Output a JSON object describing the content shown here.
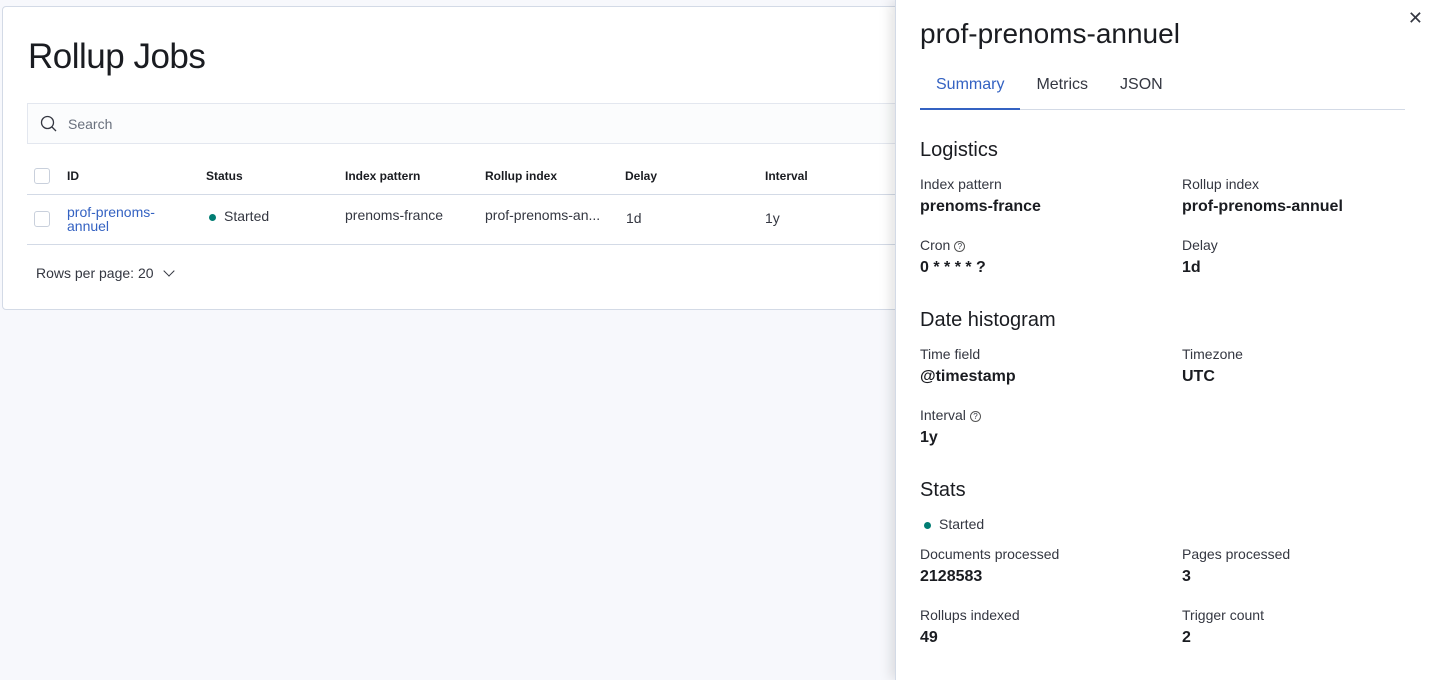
{
  "page": {
    "title": "Rollup Jobs",
    "search_placeholder": "Search"
  },
  "table": {
    "headers": [
      "ID",
      "Status",
      "Index pattern",
      "Rollup index",
      "Delay",
      "Interval"
    ],
    "rows": [
      {
        "id_line1": "prof-prenoms-",
        "id_line2": "annuel",
        "status": "Started",
        "index_pattern": "prenoms-france",
        "rollup_index": "prof-prenoms-an...",
        "delay": "1d",
        "interval": "1y"
      }
    ],
    "rows_per_page": "Rows per page: 20"
  },
  "flyout": {
    "title": "prof-prenoms-annuel",
    "tabs": [
      "Summary",
      "Metrics",
      "JSON"
    ],
    "logistics": {
      "heading": "Logistics",
      "index_pattern_label": "Index pattern",
      "index_pattern": "prenoms-france",
      "rollup_index_label": "Rollup index",
      "rollup_index": "prof-prenoms-annuel",
      "cron_label": "Cron",
      "cron": "0 * * * * ?",
      "delay_label": "Delay",
      "delay": "1d"
    },
    "date_histogram": {
      "heading": "Date histogram",
      "time_field_label": "Time field",
      "time_field": "@timestamp",
      "timezone_label": "Timezone",
      "timezone": "UTC",
      "interval_label": "Interval",
      "interval": "1y"
    },
    "stats": {
      "heading": "Stats",
      "status": "Started",
      "docs_label": "Documents processed",
      "docs": "2128583",
      "pages_label": "Pages processed",
      "pages": "3",
      "rollups_label": "Rollups indexed",
      "rollups": "49",
      "trigger_label": "Trigger count",
      "trigger": "2"
    }
  },
  "colors": {
    "accent": "#3462c2",
    "status_green": "#017d73"
  }
}
